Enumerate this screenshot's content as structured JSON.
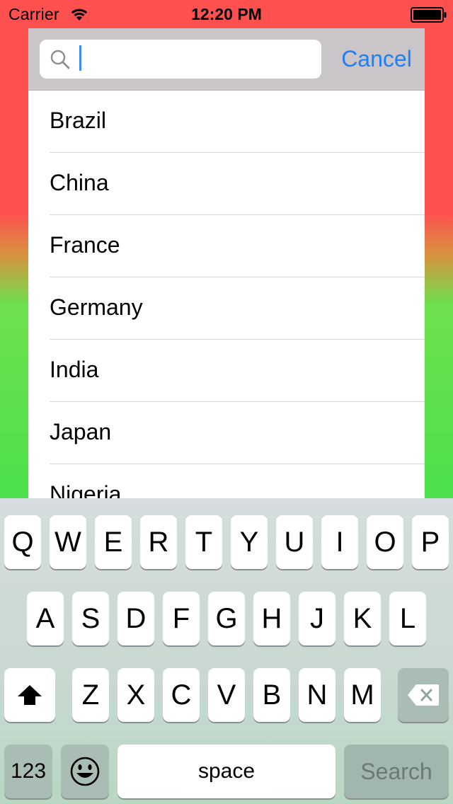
{
  "status_bar": {
    "carrier": "Carrier",
    "time": "12:20 PM",
    "wifi_icon": "wifi-icon",
    "battery_icon": "battery-full-icon"
  },
  "search": {
    "value": "",
    "placeholder": "",
    "cancel_label": "Cancel",
    "search_icon": "magnifying-glass-icon"
  },
  "results": [
    "Brazil",
    "China",
    "France",
    "Germany",
    "India",
    "Japan",
    "Nigeria"
  ],
  "keyboard": {
    "row1": [
      "Q",
      "W",
      "E",
      "R",
      "T",
      "Y",
      "U",
      "I",
      "O",
      "P"
    ],
    "row2": [
      "A",
      "S",
      "D",
      "F",
      "G",
      "H",
      "J",
      "K",
      "L"
    ],
    "row3": [
      "Z",
      "X",
      "C",
      "V",
      "B",
      "N",
      "M"
    ],
    "shift_icon": "shift-arrow-icon",
    "delete_icon": "backspace-icon",
    "numbers_label": "123",
    "emoji_icon": "emoji-face-icon",
    "space_label": "space",
    "search_label": "Search"
  },
  "colors": {
    "background_top": "#ff5050",
    "background_bottom": "#4ce04d",
    "accent": "#1f7ff4",
    "search_bar": "#c9c5c9"
  }
}
